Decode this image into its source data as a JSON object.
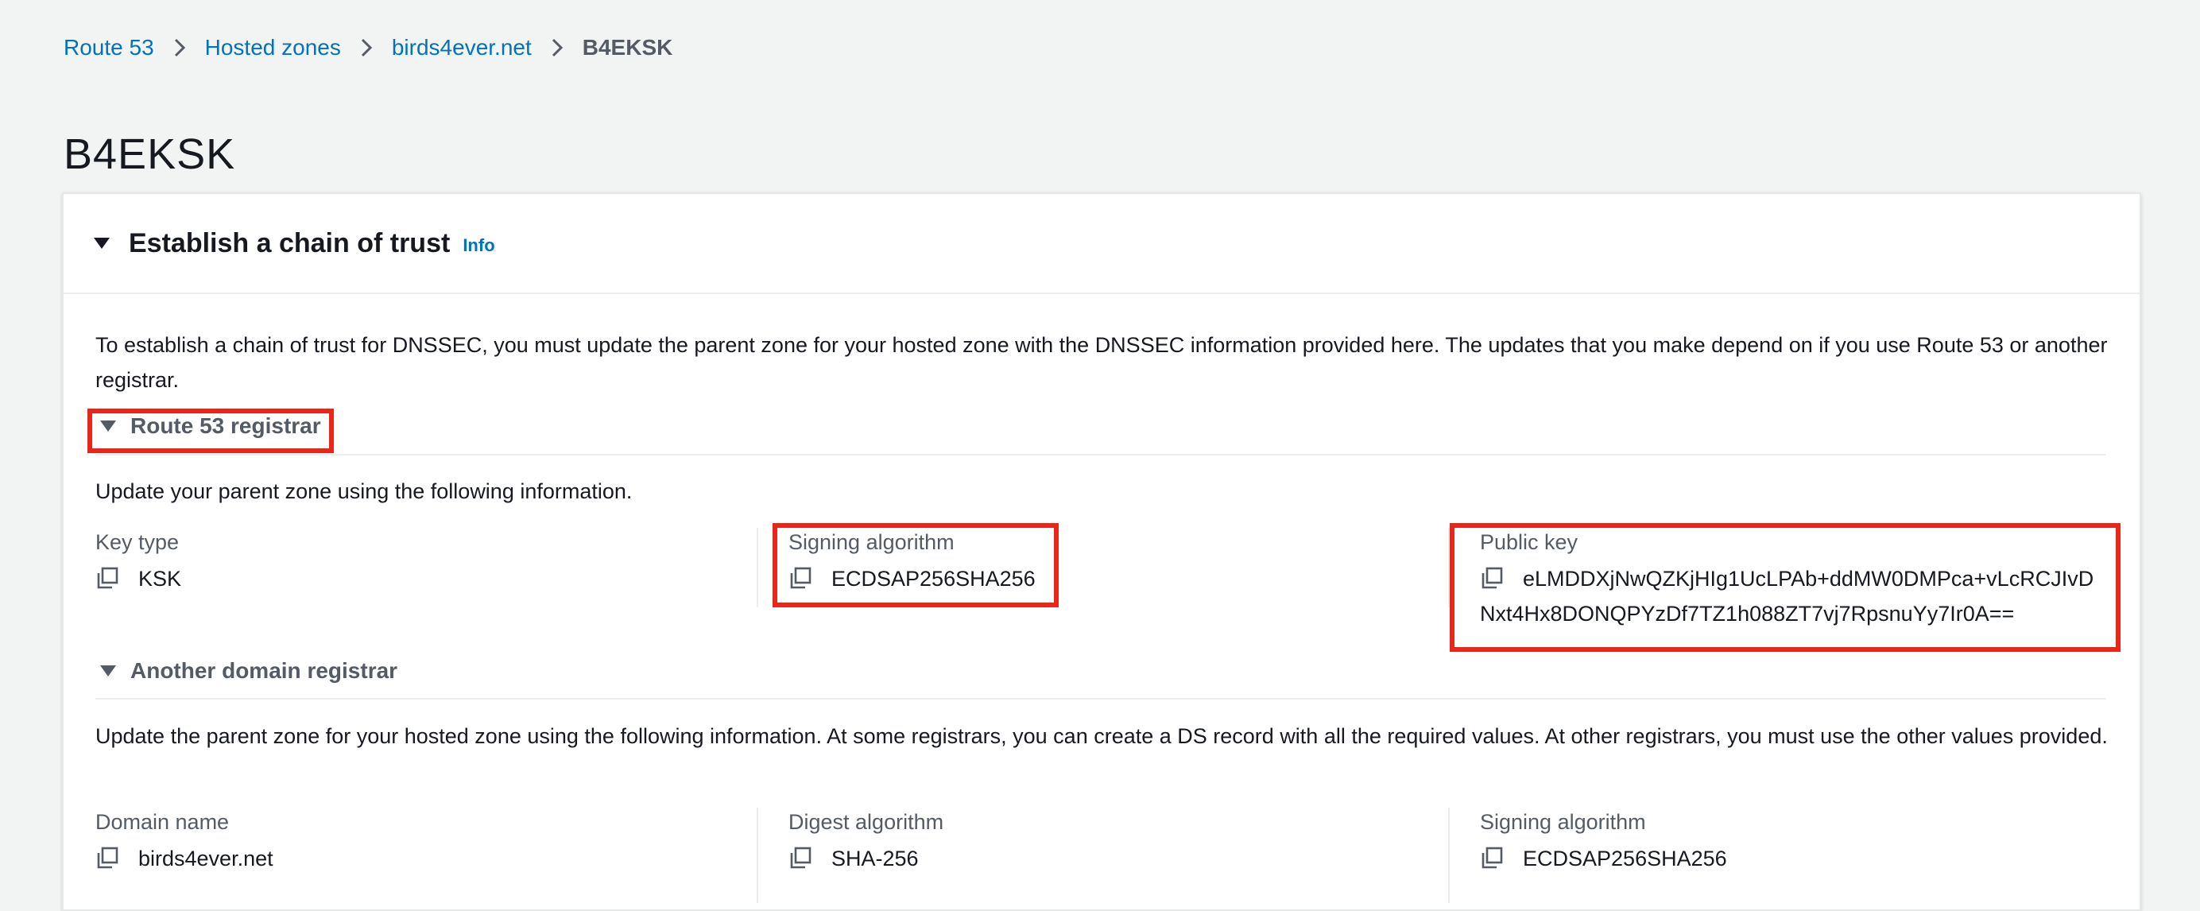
{
  "breadcrumb": {
    "items": [
      "Route 53",
      "Hosted zones",
      "birds4ever.net"
    ],
    "current": "B4EKSK"
  },
  "page_title": "B4EKSK",
  "panel": {
    "title": "Establish a chain of trust",
    "info": "Info",
    "intro": "To establish a chain of trust for DNSSEC, you must update the parent zone for your hosted zone with the DNSSEC information provided here. The updates that you make depend on if you use Route 53 or another registrar."
  },
  "route53": {
    "heading": "Route 53 registrar",
    "description": "Update your parent zone using the following information.",
    "key_type_label": "Key type",
    "key_type_value": "KSK",
    "signing_label": "Signing algorithm",
    "signing_value": "ECDSAP256SHA256",
    "public_key_label": "Public key",
    "public_key_line1": "eLMDDXjNwQZKjHIg1UcLPAb+ddMW0DMPca+vLcRCJIvD",
    "public_key_line2": "Nxt4Hx8DONQPYzDf7TZ1h088ZT7vj7RpsnuYy7Ir0A=="
  },
  "other": {
    "heading": "Another domain registrar",
    "description": "Update the parent zone for your hosted zone using the following information. At some registrars, you can create a DS record with all the required values. At other registrars, you must use the other values provided.",
    "domain_label": "Domain name",
    "domain_value": "birds4ever.net",
    "digest_label": "Digest algorithm",
    "digest_value": "SHA-256",
    "signing_label": "Signing algorithm",
    "signing_value": "ECDSAP256SHA256"
  },
  "colors": {
    "link": "#0073bb",
    "highlight": "#e8261a",
    "background": "#f2f3f3"
  },
  "icons": [
    "chevron-right-icon",
    "caret-down-icon",
    "copy-icon"
  ]
}
